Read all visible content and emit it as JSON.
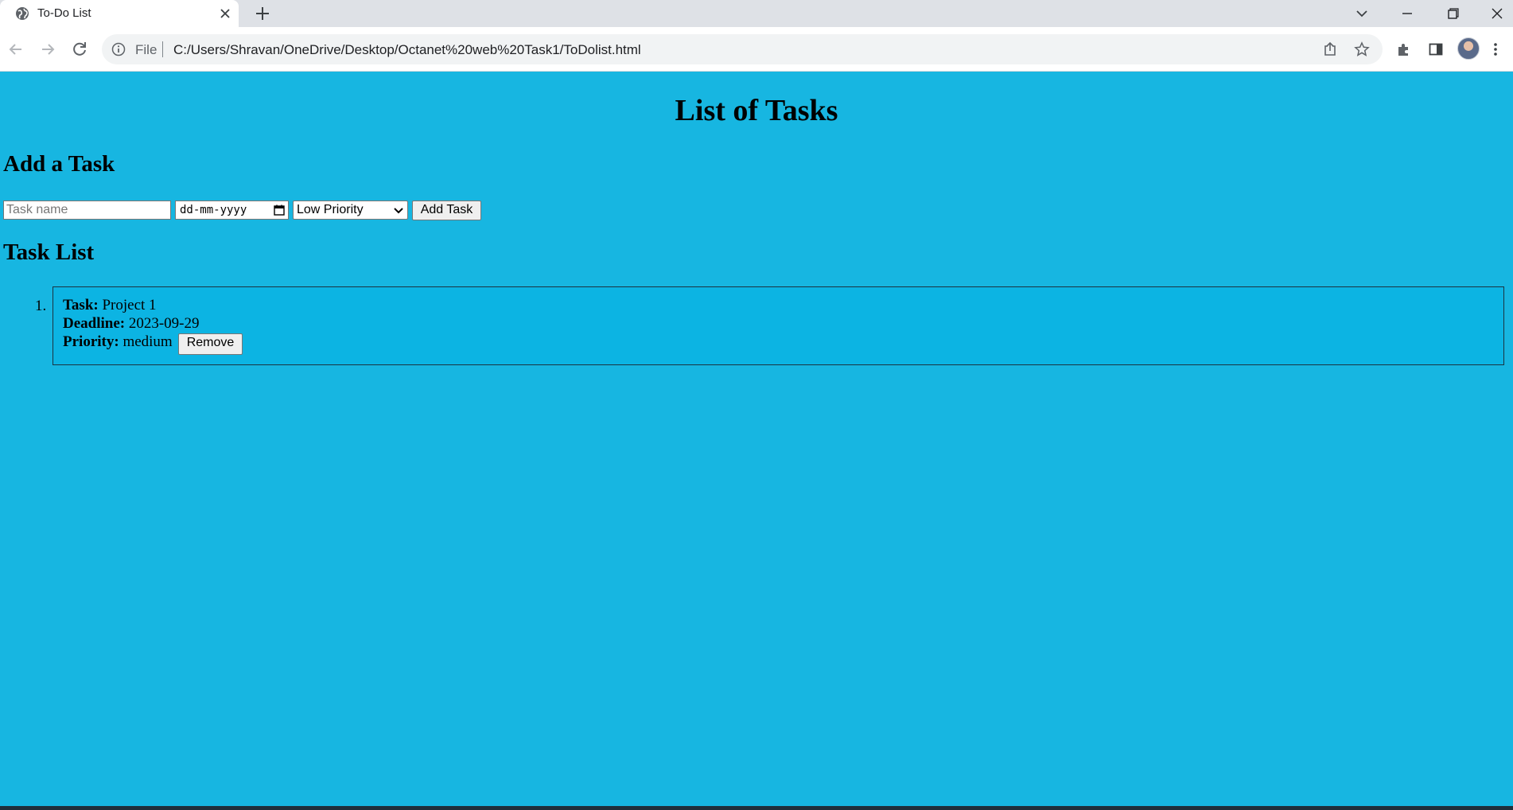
{
  "browser": {
    "tab_title": "To-Do List",
    "omnibox_scheme": "File",
    "url": "C:/Users/Shravan/OneDrive/Desktop/Octanet%20web%20Task1/ToDolist.html"
  },
  "page": {
    "heading": "List of Tasks",
    "add_section_title": "Add a Task",
    "task_name_placeholder": "Task name",
    "date_placeholder": "dd-mm-yyyy",
    "priority_selected": "Low Priority",
    "add_button": "Add Task",
    "list_section_title": "Task List",
    "tasks": [
      {
        "number": "1.",
        "task_label": "Task:",
        "task_value": "Project 1",
        "deadline_label": "Deadline:",
        "deadline_value": "2023-09-29",
        "priority_label": "Priority:",
        "priority_value": "medium",
        "remove_button": "Remove"
      }
    ]
  },
  "colors": {
    "page_background": "#17b6e1",
    "task_card_background": "#0cb4e3"
  }
}
